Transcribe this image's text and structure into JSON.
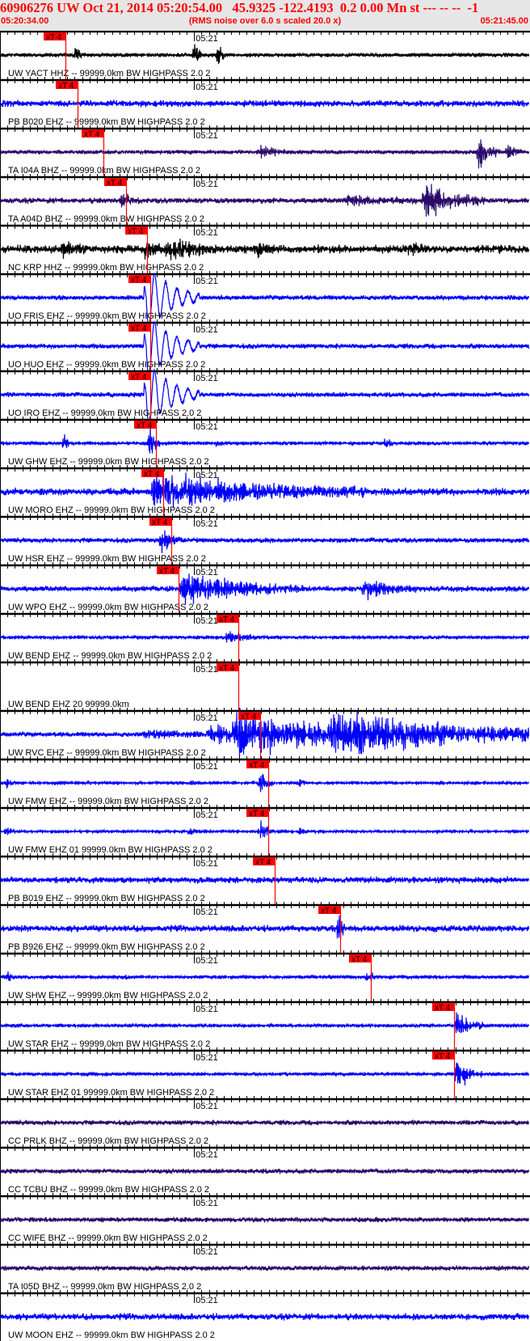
{
  "header": {
    "title": "60906276 UW Oct 21, 2014 05:20:54.00   45.9325 -122.4193  0.2 0.00 Mn st --- -- --  -1",
    "start_time": "05:20:34.00",
    "end_time": "05:21:45.00",
    "scale_note": "(RMS noise over 6.0 s scaled 20.0 x)"
  },
  "colors": {
    "header_text": "#ff0000",
    "header_bg": "#e6e6e6",
    "pick": "#ff0000",
    "black": "#000000",
    "blue": "#0000ff",
    "purple": "#2a0a6a"
  },
  "chart_data": {
    "type": "line",
    "title": "60906276 UW Oct 21, 2014 05:20:54.00   45.9325 -122.4193  0.2 0.00 Mn st --- -- --  -1",
    "x_range": [
      "05:20:34.00",
      "05:21:45.00"
    ],
    "minute_label": "05:21",
    "pick_label": "xT 4",
    "traces": [
      {
        "label": "UW YACT HHZ -- 99999.0km BW  HIGHPASS  2.0  2",
        "color": "black",
        "pick": "05:20:42.8"
      },
      {
        "label": "PB B020 EHZ -- 99999.0km BW  HIGHPASS  2.0  2",
        "color": "blue",
        "pick": "05:20:44.4"
      },
      {
        "label": "TA I04A BHZ -- 99999.0km BW  HIGHPASS  2.0  2",
        "color": "purple",
        "pick": "05:20:47.8"
      },
      {
        "label": "TA A04D BHZ -- 99999.0km BW  HIGHPASS  2.0  2",
        "color": "purple",
        "pick": "05:20:50.9"
      },
      {
        "label": "NC KRP HHZ -- 99999.0km BW  HIGHPASS  2.0  2",
        "color": "black",
        "pick": "05:20:53.7"
      },
      {
        "label": "UO FRIS EHZ -- 99999.0km BW  HIGHPASS  2.0  2",
        "color": "blue",
        "pick": "05:20:54.1"
      },
      {
        "label": "UO HUO EHZ -- 99999.0km BW  HIGHPASS  2.0  2",
        "color": "blue",
        "pick": "05:20:54.1"
      },
      {
        "label": "UO IRO EHZ -- 99999.0km BW  HIGHPASS  2.0  2",
        "color": "blue",
        "pick": "05:20:54.1"
      },
      {
        "label": "UW GHW EHZ -- 99999.0km BW  HIGHPASS  2.0  2",
        "color": "blue",
        "pick": "05:20:54.9"
      },
      {
        "label": "UW MORO EHZ -- 99999.0km BW  HIGHPASS  2.0  2",
        "color": "blue",
        "pick": "05:20:55.9"
      },
      {
        "label": "UW HSR EHZ -- 99999.0km BW  HIGHPASS  2.0  2",
        "color": "blue",
        "pick": "05:20:56.9"
      },
      {
        "label": "UW WPO EHZ -- 99999.0km BW  HIGHPASS  2.0  2",
        "color": "blue",
        "pick": "05:20:57.9"
      },
      {
        "label": "UW BEND EHZ -- 99999.0km BW  HIGHPASS  2.0  2",
        "color": "blue",
        "pick": "05:21:05.9"
      },
      {
        "label": "UW BEND EHZ 20 99999.0km",
        "color": "blue",
        "pick": "05:21:05.9"
      },
      {
        "label": "UW RVC EHZ -- 99999.0km BW  HIGHPASS  2.0  2",
        "color": "blue",
        "pick": "05:21:08.8"
      },
      {
        "label": "UW FMW EHZ -- 99999.0km BW  HIGHPASS  2.0  2",
        "color": "blue",
        "pick": "05:21:09.9"
      },
      {
        "label": "UW FMW EHZ 01 99999.0km BW  HIGHPASS  2.0  2",
        "color": "blue",
        "pick": "05:21:09.9"
      },
      {
        "label": "PB B019 EHZ -- 99999.0km BW  HIGHPASS  2.0  2",
        "color": "blue",
        "pick": "05:21:10.8"
      },
      {
        "label": "PB B926 EHZ -- 99999.0km BW  HIGHPASS  2.0  2",
        "color": "blue",
        "pick": "05:21:19.6"
      },
      {
        "label": "UW SHW EHZ -- 99999.0km BW  HIGHPASS  2.0  2",
        "color": "blue",
        "pick": "05:21:23.7"
      },
      {
        "label": "UW STAR EHZ -- 99999.0km BW  HIGHPASS  2.0  2",
        "color": "blue",
        "pick": "05:21:34.8"
      },
      {
        "label": "UW STAR EHZ 01 99999.0km BW  HIGHPASS  2.0  2",
        "color": "blue",
        "pick": "05:21:34.8"
      },
      {
        "label": "CC PRLK BHZ -- 99999.0km BW  HIGHPASS  2.0  2",
        "color": "purple",
        "pick": null
      },
      {
        "label": "CC TCBU BHZ -- 99999.0km BW  HIGHPASS  2.0  2",
        "color": "purple",
        "pick": null
      },
      {
        "label": "CC WIFE BHZ -- 99999.0km BW  HIGHPASS  2.0  2",
        "color": "purple",
        "pick": null
      },
      {
        "label": "TA I05D BHZ -- 99999.0km BW  HIGHPASS  2.0  2",
        "color": "purple",
        "pick": null
      },
      {
        "label": "UW MOON EHZ -- 99999.0km BW  HIGHPASS  2.0  2",
        "color": "blue",
        "pick": null
      }
    ]
  }
}
